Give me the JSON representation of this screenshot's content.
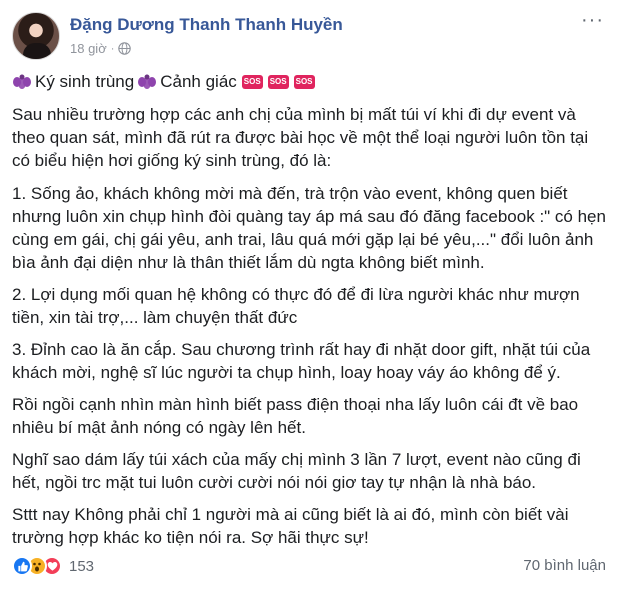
{
  "post": {
    "author": "Đặng Dương Thanh Thanh Huyền",
    "time": "18 giờ",
    "separator": "·",
    "more_label": "···",
    "title_parts": {
      "text1": "Ký sinh trùng",
      "text2": " Cảnh giác",
      "sos": "SOS"
    },
    "paragraphs": [
      "Sau nhiều trường hợp các anh chị của mình bị mất túi ví khi đi dự event và theo quan sát, mình đã rút ra được bài học về một thể loại người luôn tồn tại có biểu hiện hơi giống ký sinh trùng, đó là:",
      "1. Sống ảo, khách không mời mà đến, trà trộn vào event, không quen biết nhưng luôn xin chụp hình đòi quàng tay áp má sau đó đăng facebook :\" có hẹn cùng em gái, chị gái yêu, anh trai, lâu quá mới gặp lại bé yêu,...\" đổi luôn ảnh bìa ảnh đại diện như là thân thiết lắm dù ngta không biết mình.",
      "2. Lợi dụng mối quan hệ không có thực đó để đi lừa người khác như mượn tiền, xin tài trợ,... làm chuyện thất đức",
      "3. Đỉnh cao là ăn cắp. Sau chương trình rất hay đi nhặt door gift, nhặt túi của khách mời, nghệ sĩ lúc người ta chụp hình, loay hoay váy áo không để ý.",
      "Rồi ngồi cạnh nhìn màn hình biết pass điện thoại nha lấy luôn cái đt về bao nhiêu bí mật ảnh nóng có ngày lên hết.",
      "Nghĩ sao dám lấy túi xách của mấy chị mình 3 lần 7 lượt, event nào cũng đi hết, ngồi trc mặt tui luôn cười cười nói nói giơ tay tự nhận là nhà báo.",
      "Sttt nay Không phải chỉ 1 người mà ai cũng biết là ai đó, mình còn biết vài trường hợp khác ko tiện nói ra. Sợ hãi thực sự!"
    ],
    "reaction_count": "153",
    "comments": "70 bình luận"
  },
  "colors": {
    "author": "#385898",
    "meta": "#90949c",
    "text": "#1c1e21",
    "like": "#1877f2",
    "wow": "#f7b125",
    "love": "#f33e58",
    "sos": "#e0245e"
  }
}
